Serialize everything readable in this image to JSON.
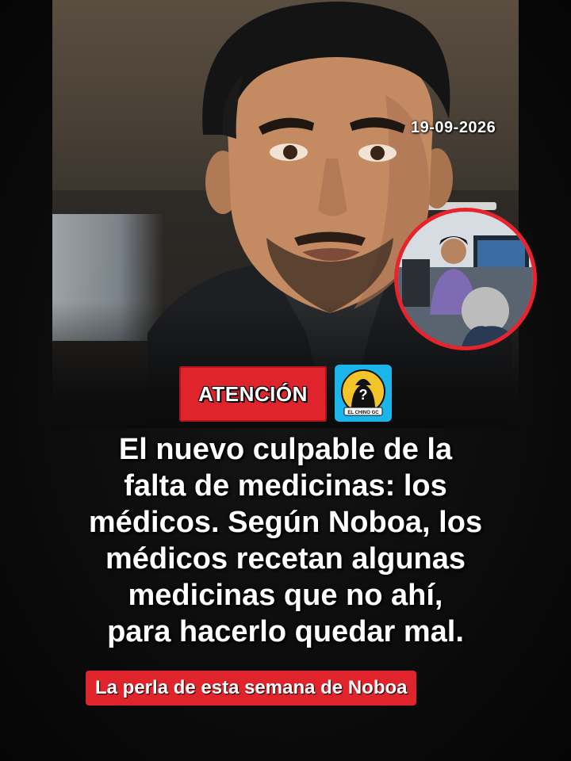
{
  "overlay": {
    "date": "19-09-2026",
    "badge_label": "ATENCIÓN",
    "logo_text": "EL CHINO GC",
    "headline_lines": [
      "El nuevo culpable de la",
      "falta de medicinas: los",
      "médicos. Según Noboa, los",
      "médicos recetan algunas",
      "medicinas que no ahí,",
      "para hacerlo quedar mal."
    ],
    "subtitle": "La perla de esta semana de Noboa"
  },
  "colors": {
    "accent_red": "#e0242c",
    "logo_blue": "#1bb5ec",
    "logo_yellow": "#f3c52a",
    "text": "#ffffff",
    "background": "#0b0b0b"
  },
  "icons": {
    "logo": "mystery-person-icon"
  }
}
